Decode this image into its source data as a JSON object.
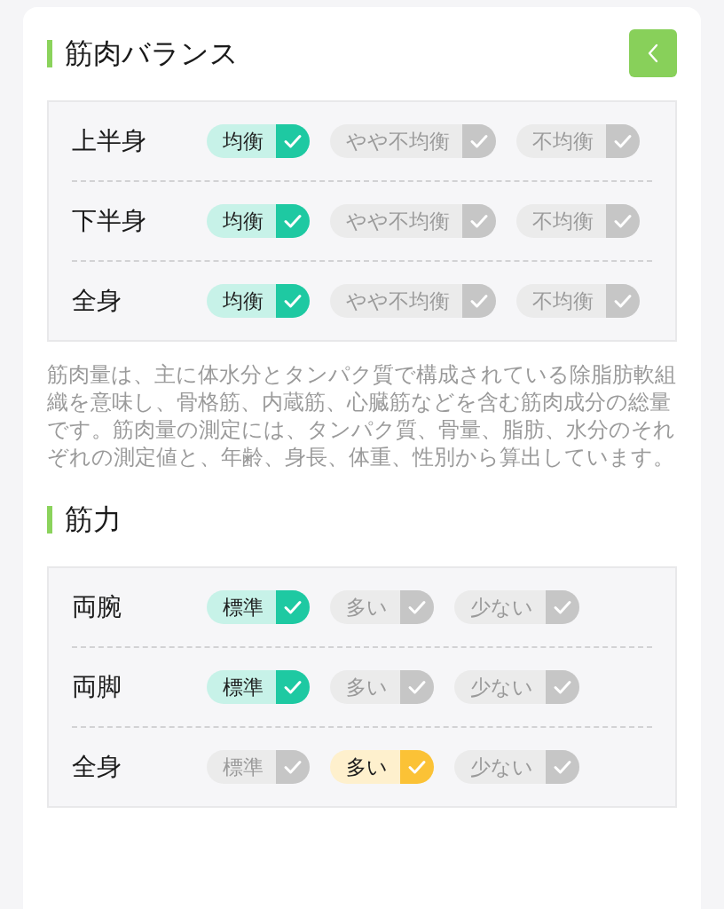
{
  "sections": [
    {
      "title": "筋肉バランス",
      "back_button": true,
      "rows": [
        {
          "label": "上半身",
          "options": [
            {
              "label": "均衡",
              "selected": true,
              "color": "#1ec9a2"
            },
            {
              "label": "やや不均衡",
              "selected": false
            },
            {
              "label": "不均衡",
              "selected": false
            }
          ]
        },
        {
          "label": "下半身",
          "options": [
            {
              "label": "均衡",
              "selected": true,
              "color": "#1ec9a2"
            },
            {
              "label": "やや不均衡",
              "selected": false
            },
            {
              "label": "不均衡",
              "selected": false
            }
          ]
        },
        {
          "label": "全身",
          "options": [
            {
              "label": "均衡",
              "selected": true,
              "color": "#1ec9a2"
            },
            {
              "label": "やや不均衡",
              "selected": false
            },
            {
              "label": "不均衡",
              "selected": false
            }
          ]
        }
      ],
      "description": "筋肉量は、主に体水分とタンパク質で構成されている除脂肪軟組織を意味し、骨格筋、内蔵筋、心臓筋などを含む筋肉成分の総量です。筋肉量の測定には、タンパク質、骨量、脂肪、水分のそれぞれの測定値と、年齢、身長、体重、性別から算出しています。"
    },
    {
      "title": "筋力",
      "back_button": false,
      "rows": [
        {
          "label": "両腕",
          "options": [
            {
              "label": "標準",
              "selected": true,
              "color": "#1ec9a2"
            },
            {
              "label": "多い",
              "selected": false
            },
            {
              "label": "少ない",
              "selected": false
            }
          ]
        },
        {
          "label": "両脚",
          "options": [
            {
              "label": "標準",
              "selected": true,
              "color": "#1ec9a2"
            },
            {
              "label": "多い",
              "selected": false
            },
            {
              "label": "少ない",
              "selected": false
            }
          ]
        },
        {
          "label": "全身",
          "options": [
            {
              "label": "標準",
              "selected": false
            },
            {
              "label": "多い",
              "selected": true,
              "color": "#fbc236"
            },
            {
              "label": "少ない",
              "selected": false
            }
          ]
        }
      ]
    }
  ]
}
